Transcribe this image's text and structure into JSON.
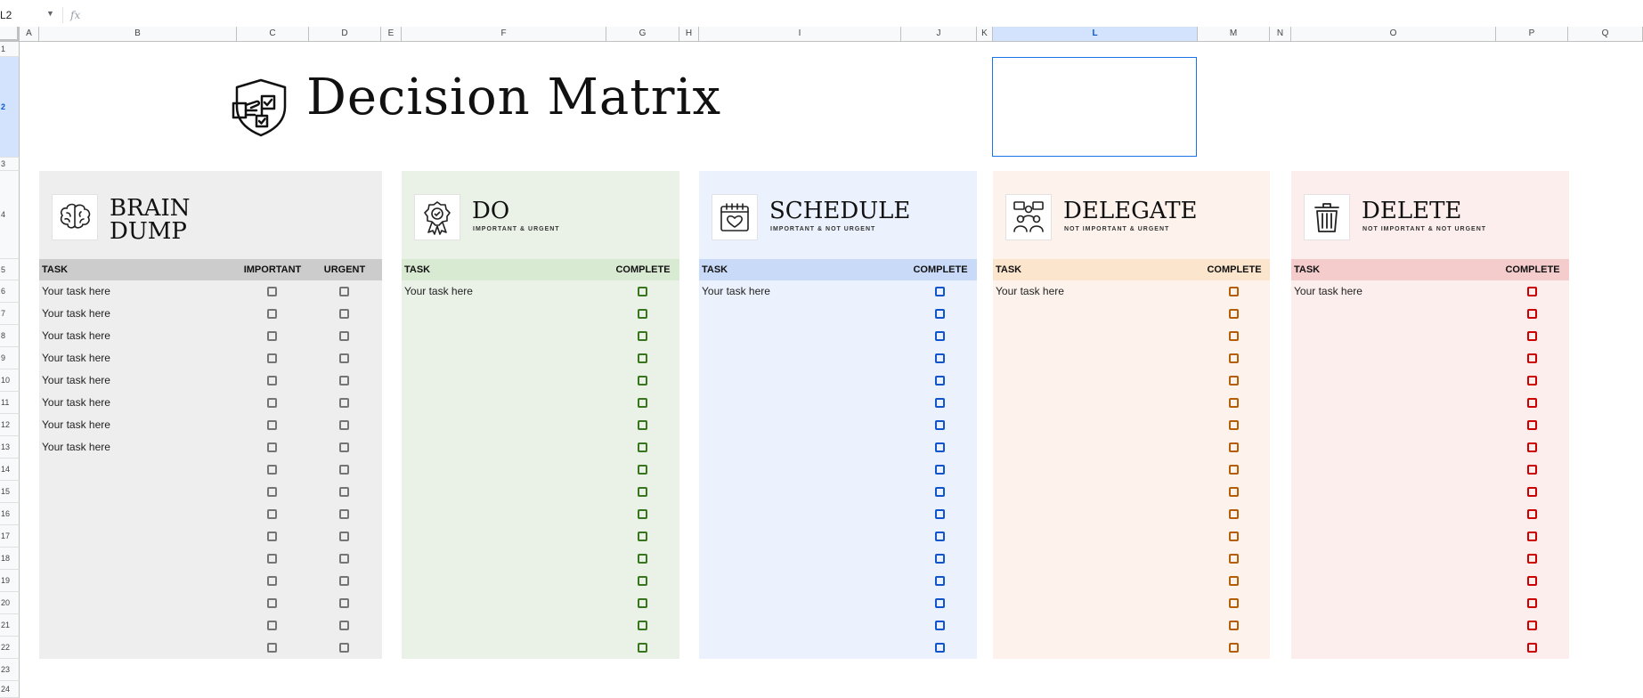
{
  "sheet": {
    "name_box": "L2",
    "fx_label": "fx",
    "columns": [
      "A",
      "B",
      "C",
      "D",
      "E",
      "F",
      "G",
      "H",
      "I",
      "J",
      "K",
      "L",
      "M",
      "N",
      "O",
      "P",
      "Q"
    ],
    "selected_column": "L",
    "rows": [
      "1",
      "2",
      "3",
      "4",
      "5",
      "6",
      "7",
      "8",
      "9",
      "10",
      "11",
      "12",
      "13",
      "14",
      "15",
      "16",
      "17",
      "18",
      "19",
      "20",
      "21",
      "22",
      "23",
      "24"
    ],
    "selected_row": "2"
  },
  "title": "Decision Matrix",
  "task_placeholder": "Your task here",
  "panels": [
    {
      "id": "brain-dump",
      "title_line1": "BRAIN",
      "title_line2": "DUMP",
      "subtitle": "",
      "icon": "brain-icon",
      "columns": [
        "TASK",
        "IMPORTANT",
        "URGENT"
      ],
      "bg": "#eeeeee",
      "header_bg": "#cccccc",
      "check_color": "#757575",
      "tasks": [
        "Your task here",
        "Your task here",
        "Your task here",
        "Your task here",
        "Your task here",
        "Your task here",
        "Your task here",
        "Your task here"
      ]
    },
    {
      "id": "do",
      "title_line1": "DO",
      "title_line2": "",
      "subtitle": "IMPORTANT & URGENT",
      "icon": "award-ribbon-icon",
      "columns": [
        "TASK",
        "COMPLETE"
      ],
      "bg": "#eaf1e6",
      "header_bg": "#d9ead3",
      "check_color": "#38761d",
      "tasks": [
        "Your task here"
      ]
    },
    {
      "id": "schedule",
      "title_line1": "SCHEDULE",
      "title_line2": "",
      "subtitle": "IMPORTANT & NOT URGENT",
      "icon": "calendar-heart-icon",
      "columns": [
        "TASK",
        "COMPLETE"
      ],
      "bg": "#ebf2fd",
      "header_bg": "#c9daf8",
      "check_color": "#1155cc",
      "tasks": [
        "Your task here"
      ]
    },
    {
      "id": "delegate",
      "title_line1": "DELEGATE",
      "title_line2": "",
      "subtitle": "NOT IMPORTANT & URGENT",
      "icon": "team-meeting-icon",
      "columns": [
        "TASK",
        "COMPLETE"
      ],
      "bg": "#fdf3ec",
      "header_bg": "#fce5cd",
      "check_color": "#b45f06",
      "tasks": [
        "Your task here"
      ]
    },
    {
      "id": "delete",
      "title_line1": "DELETE",
      "title_line2": "",
      "subtitle": "NOT IMPORTANT & NOT URGENT",
      "icon": "trash-can-icon",
      "columns": [
        "TASK",
        "COMPLETE"
      ],
      "bg": "#fdeeee",
      "header_bg": "#f4cccc",
      "check_color": "#cc0000",
      "tasks": [
        "Your task here"
      ]
    }
  ]
}
